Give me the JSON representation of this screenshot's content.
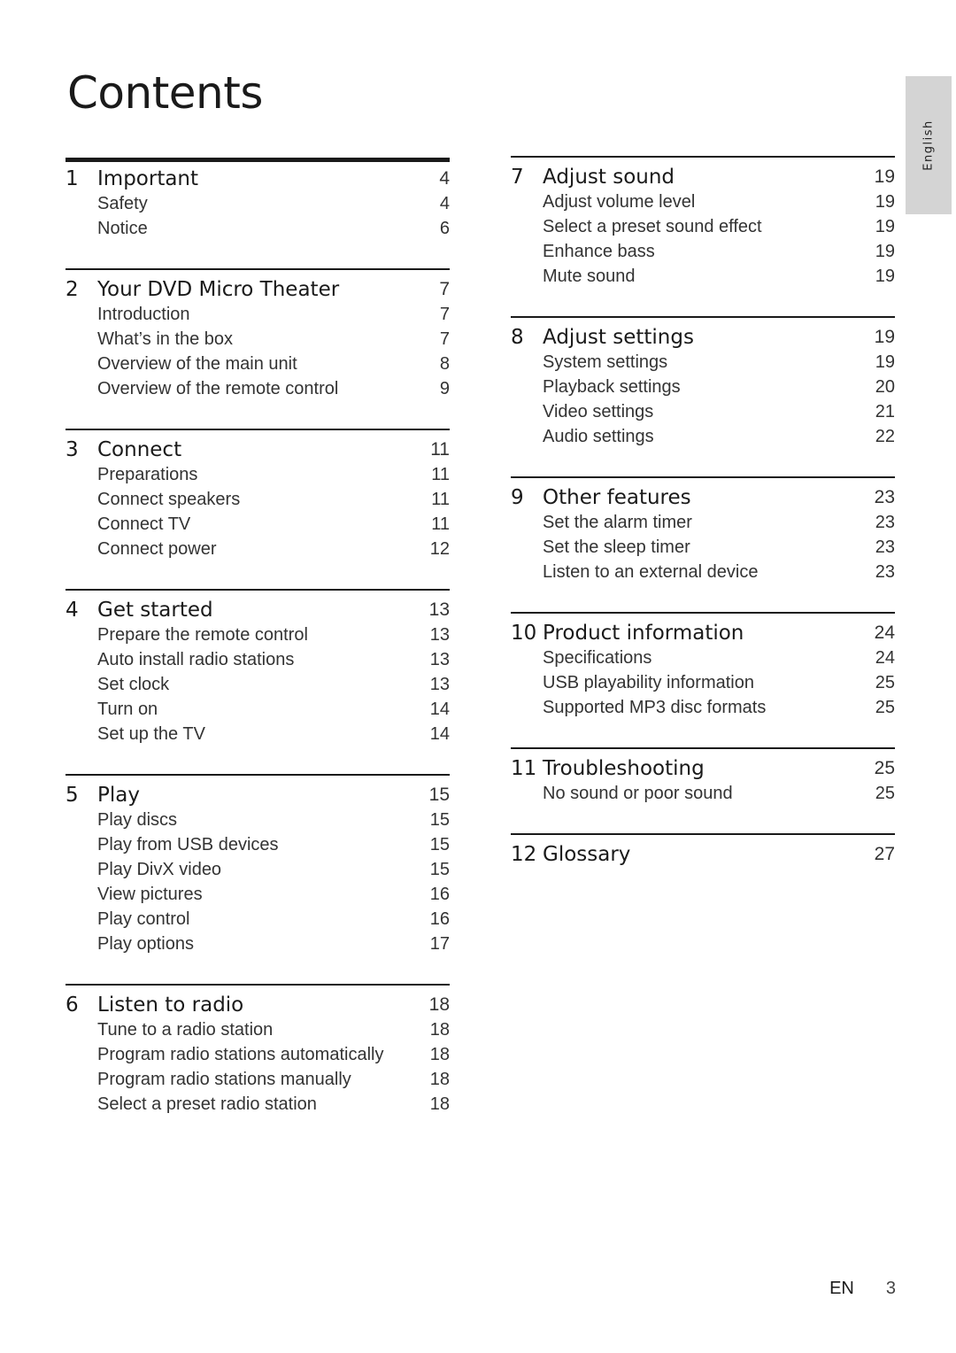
{
  "title": "Contents",
  "language_tab": "English",
  "footer": {
    "lang": "EN",
    "page": "3"
  },
  "left_sections": [
    {
      "num": "1",
      "title": "Important",
      "page": "4",
      "items": [
        {
          "label": "Safety",
          "page": "4"
        },
        {
          "label": "Notice",
          "page": "6"
        }
      ]
    },
    {
      "num": "2",
      "title": "Your DVD Micro Theater",
      "page": "7",
      "items": [
        {
          "label": "Introduction",
          "page": "7"
        },
        {
          "label": "What’s in the box",
          "page": "7"
        },
        {
          "label": "Overview of the main unit",
          "page": "8"
        },
        {
          "label": "Overview of the remote control",
          "page": "9"
        }
      ]
    },
    {
      "num": "3",
      "title": "Connect",
      "page": "11",
      "items": [
        {
          "label": "Preparations",
          "page": "11"
        },
        {
          "label": "Connect speakers",
          "page": "11"
        },
        {
          "label": "Connect TV",
          "page": "11"
        },
        {
          "label": "Connect power",
          "page": "12"
        }
      ]
    },
    {
      "num": "4",
      "title": "Get started",
      "page": "13",
      "items": [
        {
          "label": "Prepare the remote control",
          "page": "13"
        },
        {
          "label": "Auto install radio stations",
          "page": "13"
        },
        {
          "label": "Set clock",
          "page": "13"
        },
        {
          "label": "Turn on",
          "page": "14"
        },
        {
          "label": "Set up the TV",
          "page": "14"
        }
      ]
    },
    {
      "num": "5",
      "title": "Play",
      "page": "15",
      "items": [
        {
          "label": "Play discs",
          "page": "15"
        },
        {
          "label": "Play from USB devices",
          "page": "15"
        },
        {
          "label": "Play DivX video",
          "page": "15"
        },
        {
          "label": "View pictures",
          "page": "16"
        },
        {
          "label": "Play control",
          "page": "16"
        },
        {
          "label": "Play options",
          "page": "17"
        }
      ]
    },
    {
      "num": "6",
      "title": "Listen to radio",
      "page": "18",
      "items": [
        {
          "label": "Tune to a radio station",
          "page": "18"
        },
        {
          "label": "Program radio stations automatically",
          "page": "18"
        },
        {
          "label": "Program radio stations manually",
          "page": "18"
        },
        {
          "label": "Select a preset radio station",
          "page": "18"
        }
      ]
    }
  ],
  "right_sections": [
    {
      "num": "7",
      "title": "Adjust sound",
      "page": "19",
      "items": [
        {
          "label": "Adjust volume level",
          "page": "19"
        },
        {
          "label": "Select a preset sound effect",
          "page": "19"
        },
        {
          "label": "Enhance bass",
          "page": "19"
        },
        {
          "label": "Mute sound",
          "page": "19"
        }
      ]
    },
    {
      "num": "8",
      "title": "Adjust settings",
      "page": "19",
      "items": [
        {
          "label": "System settings",
          "page": "19"
        },
        {
          "label": "Playback settings",
          "page": "20"
        },
        {
          "label": "Video settings",
          "page": "21"
        },
        {
          "label": "Audio settings",
          "page": "22"
        }
      ]
    },
    {
      "num": "9",
      "title": "Other features",
      "page": "23",
      "items": [
        {
          "label": "Set the alarm timer",
          "page": "23"
        },
        {
          "label": "Set the sleep timer",
          "page": "23"
        },
        {
          "label": "Listen to an external device",
          "page": "23"
        }
      ]
    },
    {
      "num": "10",
      "title": "Product information",
      "page": "24",
      "items": [
        {
          "label": "Specifications",
          "page": "24"
        },
        {
          "label": "USB playability information",
          "page": "25"
        },
        {
          "label": "Supported MP3 disc formats",
          "page": "25"
        }
      ]
    },
    {
      "num": "11",
      "title": "Troubleshooting",
      "page": "25",
      "items": [
        {
          "label": "No sound or poor sound",
          "page": "25"
        }
      ]
    },
    {
      "num": "12",
      "title": "Glossary",
      "page": "27",
      "items": []
    }
  ]
}
